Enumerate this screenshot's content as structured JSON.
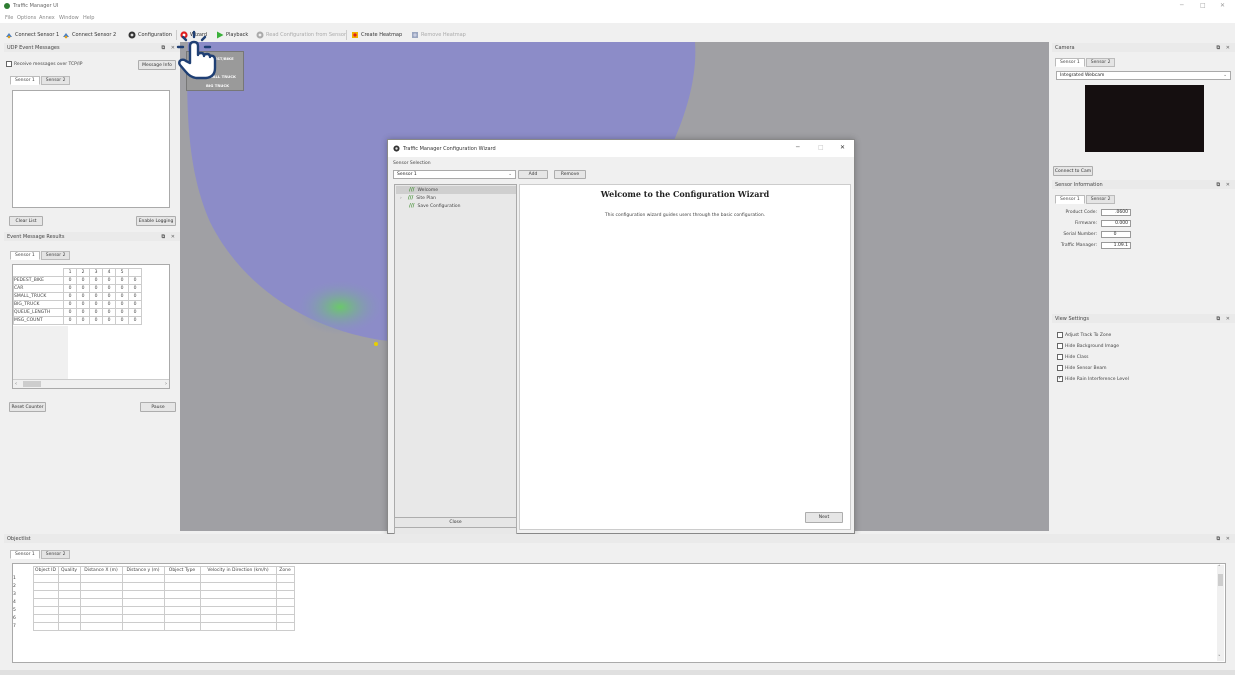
{
  "window": {
    "title": "Traffic Manager UI",
    "minimize": "─",
    "maximize": "□",
    "close": "✕"
  },
  "menu": [
    "File",
    "Options",
    "Annex",
    "Window",
    "Help"
  ],
  "toolbar": {
    "connect1": "Connect Sensor 1",
    "connect2": "Connect Sensor 2",
    "configuration": "Configuration",
    "wizard": "Wizard",
    "playback": "Playback",
    "read_config": "Read Configuration from Sensor",
    "create_heatmap": "Create Heatmap",
    "remove_heatmap": "Remove Heatmap"
  },
  "udp": {
    "title": "UDP Event Messages",
    "checkbox": "Receive messages over TCP/IP",
    "msginfo_btn": "Message Info",
    "tabs": [
      "Sensor 1",
      "Sensor 2"
    ],
    "clear_btn": "Clear List",
    "logging_btn": "Enable Logging"
  },
  "results": {
    "title": "Event Message Results",
    "tabs": [
      "Sensor 1",
      "Sensor 2"
    ],
    "columns": [
      "1",
      "2",
      "3",
      "4",
      "5",
      ""
    ],
    "rows": [
      {
        "label": "PEDEST_BIKE",
        "vals": [
          "0",
          "0",
          "0",
          "0",
          "0",
          "0"
        ]
      },
      {
        "label": "CAR",
        "vals": [
          "0",
          "0",
          "0",
          "0",
          "0",
          "0"
        ]
      },
      {
        "label": "SMALL_TRUCK",
        "vals": [
          "0",
          "0",
          "0",
          "0",
          "0",
          "0"
        ]
      },
      {
        "label": "BIG_TRUCK",
        "vals": [
          "0",
          "0",
          "0",
          "0",
          "0",
          "0"
        ]
      },
      {
        "label": "QUEUE_LENGTH",
        "vals": [
          "0",
          "0",
          "0",
          "0",
          "0",
          "0"
        ]
      },
      {
        "label": "MSG_COUNT",
        "vals": [
          "0",
          "0",
          "0",
          "0",
          "0",
          "0"
        ]
      }
    ],
    "reset_btn": "Reset Counter",
    "pause_btn": "Pause"
  },
  "wizard_popup": {
    "items": [
      "PEDEST/BIKE",
      "CAR",
      "SMALL TRUCK",
      "BIG TRUCK"
    ]
  },
  "wizard": {
    "title": "Traffic Manager Configuration Wizard",
    "sensor_label": "Sensor Selection",
    "sensor_value": "Sensor 1",
    "add_btn": "Add",
    "remove_btn": "Remove",
    "steps": [
      "Welcome",
      "Site Plan",
      "Save Configuration"
    ],
    "heading": "Welcome to the Configuration Wizard",
    "description": "This configuration wizard guides users through the basic configuration.",
    "close_btn": "Close",
    "next_btn": "Next"
  },
  "camera": {
    "title": "Camera",
    "tabs": [
      "Sensor 1",
      "Sensor 2"
    ],
    "source": "Integrated Webcam",
    "connect_btn": "Connect to Cam"
  },
  "sensor_info": {
    "title": "Sensor Information",
    "tabs": [
      "Sensor 1",
      "Sensor 2"
    ],
    "fields": [
      {
        "label": "Product Code:",
        "value": ".0600"
      },
      {
        "label": "Firmware:",
        "value": "0.000"
      },
      {
        "label": "Serial Number:",
        "value": "0"
      },
      {
        "label": "Traffic Manager:",
        "value": "1.09.1"
      }
    ]
  },
  "view_settings": {
    "title": "View Settings",
    "options": [
      {
        "label": "Adjust Track To Zone",
        "checked": false
      },
      {
        "label": "Hide Background Image",
        "checked": false
      },
      {
        "label": "Hide Class",
        "checked": false
      },
      {
        "label": "Hide Sensor Beam",
        "checked": false
      },
      {
        "label": "Hide Rain Interference Level",
        "checked": true
      }
    ]
  },
  "objectlist": {
    "title": "Objectlist",
    "tabs": [
      "Sensor 1",
      "Sensor 2"
    ],
    "columns": [
      "Object ID",
      "Quality",
      "Distance X (m)",
      "Distance y (m)",
      "Object Type",
      "Velocity in Direction (km/h)",
      "Zone"
    ],
    "row_numbers": [
      "1",
      "2",
      "3",
      "4",
      "5",
      "6",
      "7"
    ]
  },
  "colors": {
    "accent_green": "#3a8a2a",
    "hand_blue": "#1f3f74",
    "beam": "#8c8cc8",
    "canvas": "#a0a0a4"
  },
  "icons": [
    "hand-pointer-icon",
    "record-icon",
    "play-icon",
    "gear-icon",
    "heatmap-icon"
  ]
}
